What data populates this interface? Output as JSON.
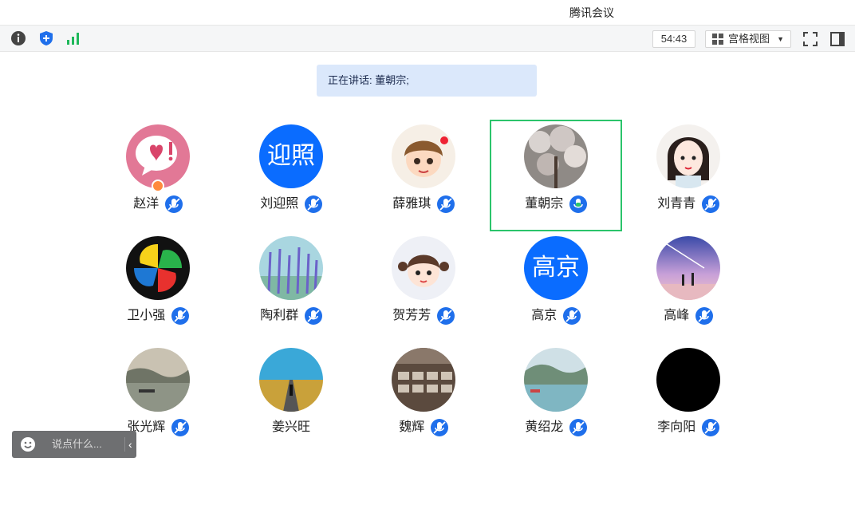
{
  "window": {
    "title": "腾讯会议"
  },
  "toolbar": {
    "timer": "54:43",
    "view_label": "宫格视图",
    "icons": [
      "info-icon",
      "shield-icon",
      "signal-icon",
      "grid-icon",
      "fullscreen-icon",
      "side-panel-icon"
    ]
  },
  "speaking": {
    "text": "正在讲话: 董朝宗;"
  },
  "participants": [
    {
      "name": "赵洋",
      "mic": "muted",
      "host": true
    },
    {
      "name": "刘迎照",
      "mic": "muted",
      "avatar_text": "迎照"
    },
    {
      "name": "薛雅琪",
      "mic": "muted"
    },
    {
      "name": "董朝宗",
      "mic": "speaking",
      "active": true
    },
    {
      "name": "刘青青",
      "mic": "muted"
    },
    {
      "name": "卫小强",
      "mic": "muted"
    },
    {
      "name": "陶利群",
      "mic": "muted"
    },
    {
      "name": "贺芳芳",
      "mic": "muted"
    },
    {
      "name": "高京",
      "mic": "muted",
      "avatar_text": "高京"
    },
    {
      "name": "高峰",
      "mic": "muted"
    },
    {
      "name": "张光辉",
      "mic": "muted"
    },
    {
      "name": "姜兴旺",
      "mic": "none"
    },
    {
      "name": "魏辉",
      "mic": "muted"
    },
    {
      "name": "黄绍龙",
      "mic": "muted"
    },
    {
      "name": "李向阳",
      "mic": "muted"
    }
  ],
  "chat": {
    "placeholder": "说点什么..."
  },
  "colors": {
    "accent": "#0a6cff",
    "active_border": "#2bc46b",
    "speaking_bg": "#dbe8fb"
  }
}
